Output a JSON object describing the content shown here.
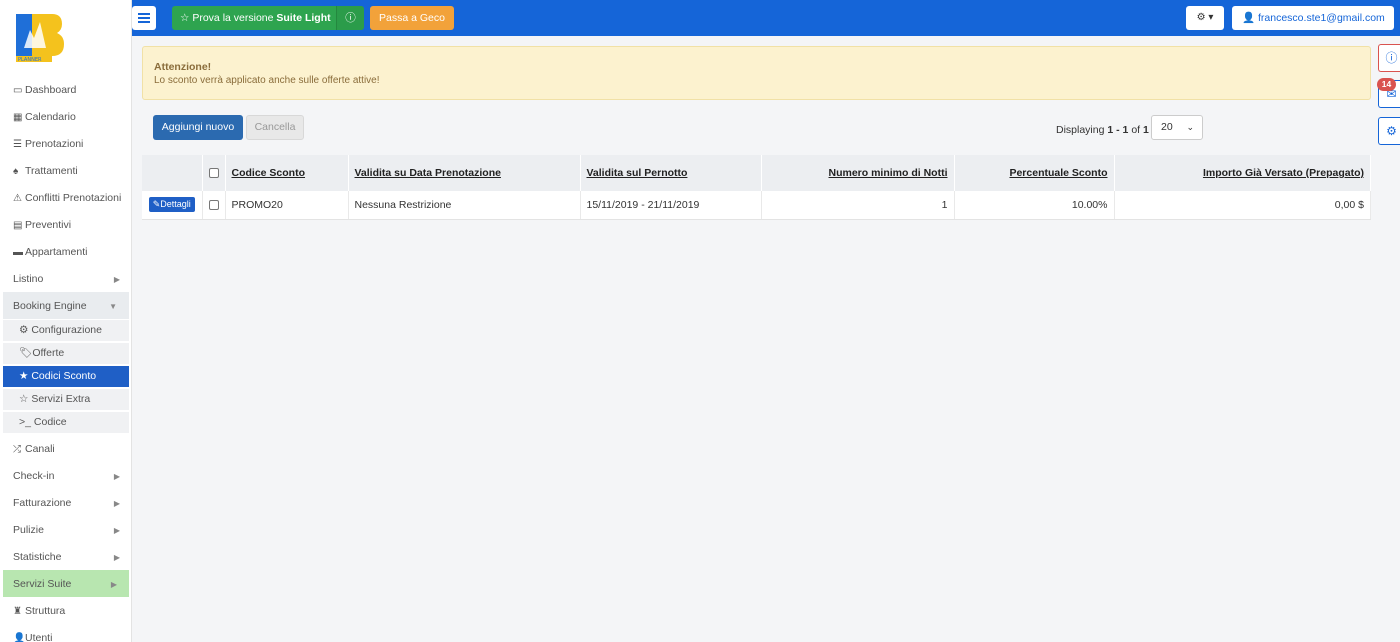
{
  "topbar": {
    "trial_prefix": "Prova la versione",
    "trial_bold": "Suite Light",
    "geco_label": "Passa a Geco",
    "gear_label": "⚙ ▾",
    "user_email": "francesco.ste1@gmail.com"
  },
  "sidebar": {
    "items": [
      {
        "label": "Dashboard",
        "icon": "▭"
      },
      {
        "label": "Calendario",
        "icon": "▦"
      },
      {
        "label": "Prenotazioni",
        "icon": "☰"
      },
      {
        "label": "Trattamenti",
        "icon": "♠"
      },
      {
        "label": "Conflitti Prenotazioni",
        "icon": "⚠"
      },
      {
        "label": "Preventivi",
        "icon": "▤"
      },
      {
        "label": "Appartamenti",
        "icon": "▬"
      },
      {
        "label": "Listino",
        "icon": ""
      },
      {
        "label": "Booking Engine",
        "icon": ""
      },
      {
        "label": "Canali",
        "icon": "⤮"
      },
      {
        "label": "Check-in",
        "icon": ""
      },
      {
        "label": "Fatturazione",
        "icon": ""
      },
      {
        "label": "Pulizie",
        "icon": ""
      },
      {
        "label": "Statistiche",
        "icon": ""
      },
      {
        "label": "Servizi Suite",
        "icon": ""
      },
      {
        "label": "Struttura",
        "icon": "♜"
      },
      {
        "label": "Utenti",
        "icon": "👤"
      }
    ],
    "booking_sub": [
      {
        "label": "Configurazione",
        "icon": "⚙"
      },
      {
        "label": "Offerte",
        "icon": "🏷"
      },
      {
        "label": "Codici Sconto",
        "icon": "★"
      },
      {
        "label": "Servizi Extra",
        "icon": "☆"
      },
      {
        "label": "Codice",
        "icon": ">_"
      }
    ]
  },
  "right": {
    "badge": "14"
  },
  "alert": {
    "title": "Attenzione!",
    "text": "Lo sconto verrà applicato anche sulle offerte attive!"
  },
  "actions": {
    "add_label": "Aggiungi nuovo",
    "delete_label": "Cancella",
    "displaying_prefix": "Displaying",
    "range": "1 - 1",
    "of": "of",
    "total": "1",
    "page_size": "20"
  },
  "table": {
    "headers": [
      "Codice Sconto",
      "Validita su Data Prenotazione",
      "Validita sul Pernotto",
      "Numero minimo di Notti",
      "Percentuale Sconto",
      "Importo Già Versato (Prepagato)"
    ],
    "details_label": "Dettagli",
    "rows": [
      [
        "PROMO20",
        "Nessuna Restrizione",
        "15/11/2019 - 21/11/2019",
        "1",
        "10.00%",
        "0,00 $"
      ]
    ]
  }
}
